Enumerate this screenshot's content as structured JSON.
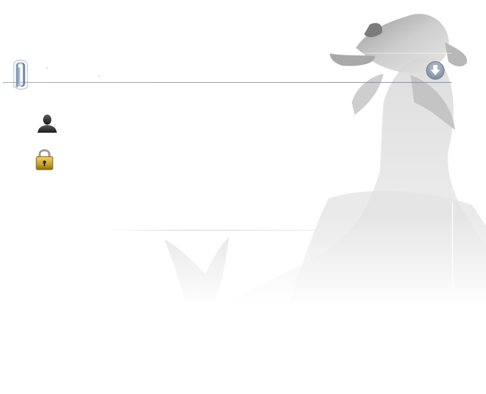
{
  "icons": {
    "attachment": "paperclip-icon",
    "download": "download-arrow-icon",
    "user": "user-silhouette-icon",
    "lock": "padlock-icon"
  },
  "fields": {
    "username": {
      "value": "",
      "placeholder": ""
    },
    "password": {
      "value": "",
      "placeholder": ""
    }
  },
  "colors": {
    "accent": "#7a8ea6",
    "download_button": "#8c9cb0",
    "lock_body": "#c9a227"
  }
}
